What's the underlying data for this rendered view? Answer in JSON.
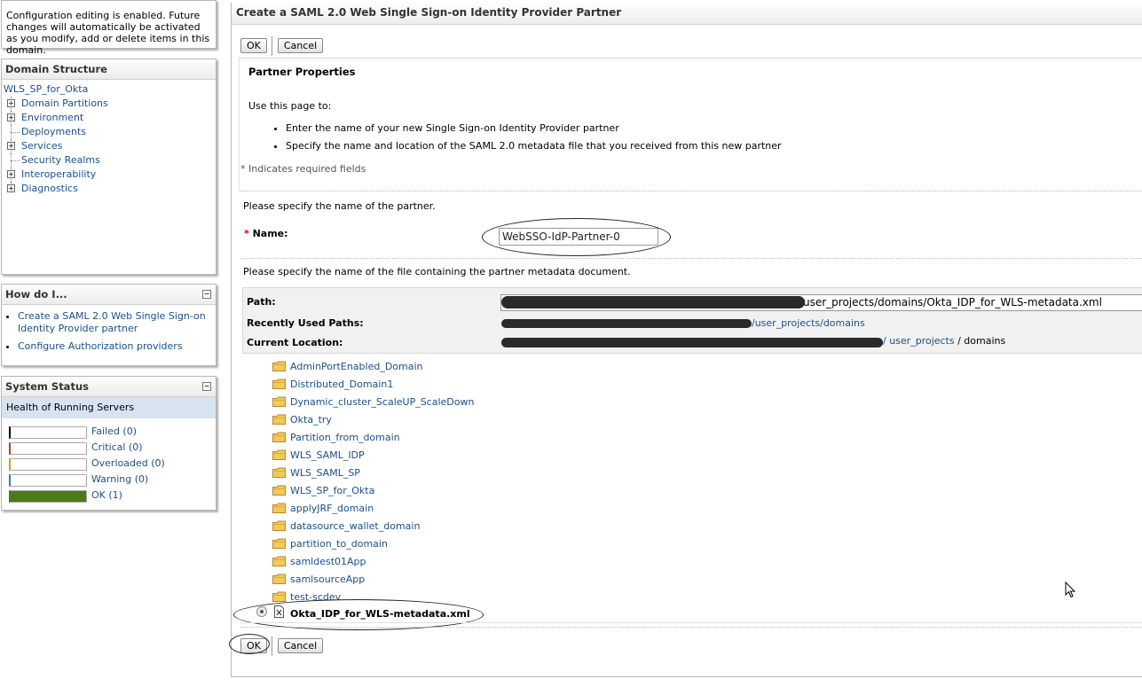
{
  "change_center": {
    "message": "Configuration editing is enabled. Future changes will automatically be activated as you modify, add or delete items in this domain."
  },
  "domain_structure": {
    "title": "Domain Structure",
    "root": "WLS_SP_for_Okta",
    "items": [
      {
        "label": "Domain Partitions",
        "expandable": true
      },
      {
        "label": "Environment",
        "expandable": true
      },
      {
        "label": "Deployments",
        "expandable": false
      },
      {
        "label": "Services",
        "expandable": true
      },
      {
        "label": "Security Realms",
        "expandable": false
      },
      {
        "label": "Interoperability",
        "expandable": true
      },
      {
        "label": "Diagnostics",
        "expandable": true
      }
    ]
  },
  "how_do_i": {
    "title": "How do I...",
    "links": [
      "Create a SAML 2.0 Web Single Sign-on Identity Provider partner",
      "Configure Authorization providers"
    ]
  },
  "system_status": {
    "title": "System Status",
    "subtitle": "Health of Running Servers",
    "rows": [
      {
        "label": "Failed (0)",
        "color": "#000000",
        "fill": 0
      },
      {
        "label": "Critical (0)",
        "color": "#c0392b",
        "fill": 0
      },
      {
        "label": "Overloaded (0)",
        "color": "#d4a017",
        "fill": 0
      },
      {
        "label": "Warning (0)",
        "color": "#2a7fbf",
        "fill": 0
      },
      {
        "label": "OK (1)",
        "color": "#4d7a18",
        "fill": 1
      }
    ]
  },
  "main": {
    "title": "Create a SAML 2.0 Web Single Sign-on Identity Provider Partner",
    "ok_label": "OK",
    "cancel_label": "Cancel",
    "section_title": "Partner Properties",
    "intro": "Use this page to:",
    "bullets": [
      "Enter the name of your new Single Sign-on Identity Provider partner",
      "Specify the name and location of the SAML 2.0 metadata file that you received from this new partner"
    ],
    "required_note": "* Indicates required fields",
    "name_prompt": "Please specify the name of the partner.",
    "name_label": "Name:",
    "name_value": "WebSSO-IdP-Partner-0",
    "file_prompt": "Please specify the name of the file containing the partner metadata document.",
    "path_label": "Path:",
    "path_value": "user_projects/domains/Okta_IDP_for_WLS-metadata.xml",
    "recent_label": "Recently Used Paths:",
    "recent_value": "/user_projects/domains",
    "location_label": "Current Location:",
    "location_link": "/ user_projects",
    "location_tail": "/ domains",
    "folders": [
      "AdminPortEnabled_Domain",
      "Distributed_Domain1",
      "Dynamic_cluster_ScaleUP_ScaleDown",
      "Okta_try",
      "Partition_from_domain",
      "WLS_SAML_IDP",
      "WLS_SAML_SP",
      "WLS_SP_for_Okta",
      "applyJRF_domain",
      "datasource_wallet_domain",
      "partition_to_domain",
      "samldest01App",
      "samlsourceApp",
      "test-scdev"
    ],
    "selected_file": "Okta_IDP_for_WLS-metadata.xml"
  }
}
